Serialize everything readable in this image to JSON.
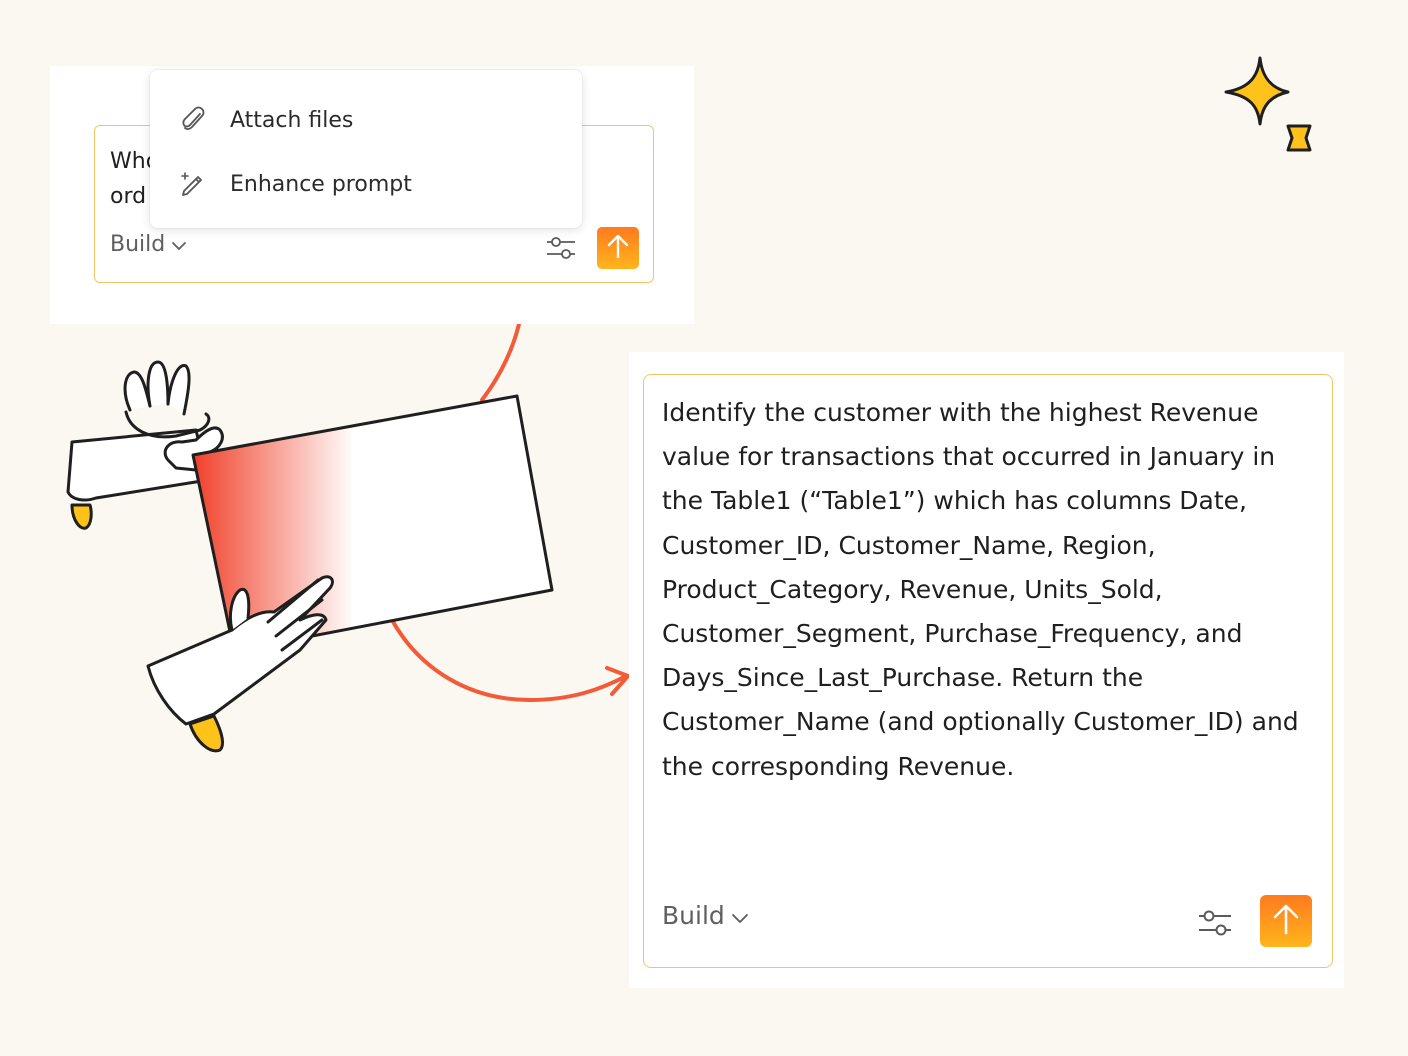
{
  "top_card": {
    "input_text": "Who\nord",
    "menu": {
      "items": [
        {
          "label": "Attach files",
          "icon": "paperclip-icon"
        },
        {
          "label": "Enhance prompt",
          "icon": "magic-pen-icon"
        }
      ]
    },
    "mode_label": "Build",
    "settings_icon": "sliders-icon",
    "send_icon": "arrow-up-icon"
  },
  "bottom_card": {
    "input_text": "Identify the customer with the highest Revenue value for transactions that occurred in January in the Table1 (“Table1”) which has columns Date, Customer_ID, Customer_Name, Region, Product_Category, Revenue, Units_Sold, Customer_Segment, Purchase_Frequency, and Days_Since_Last_Purchase. Return the Customer_Name (and optionally Customer_ID) and the corresponding Revenue.",
    "mode_label": "Build",
    "settings_icon": "sliders-icon",
    "send_icon": "arrow-up-icon"
  },
  "colors": {
    "background": "#fbf8f1",
    "input_border": "#f2c46a",
    "send_gradient_top": "#ff7a1e",
    "send_gradient_bottom": "#ffb51c",
    "arrow": "#f25a38",
    "sparkle": "#ffc21a"
  }
}
